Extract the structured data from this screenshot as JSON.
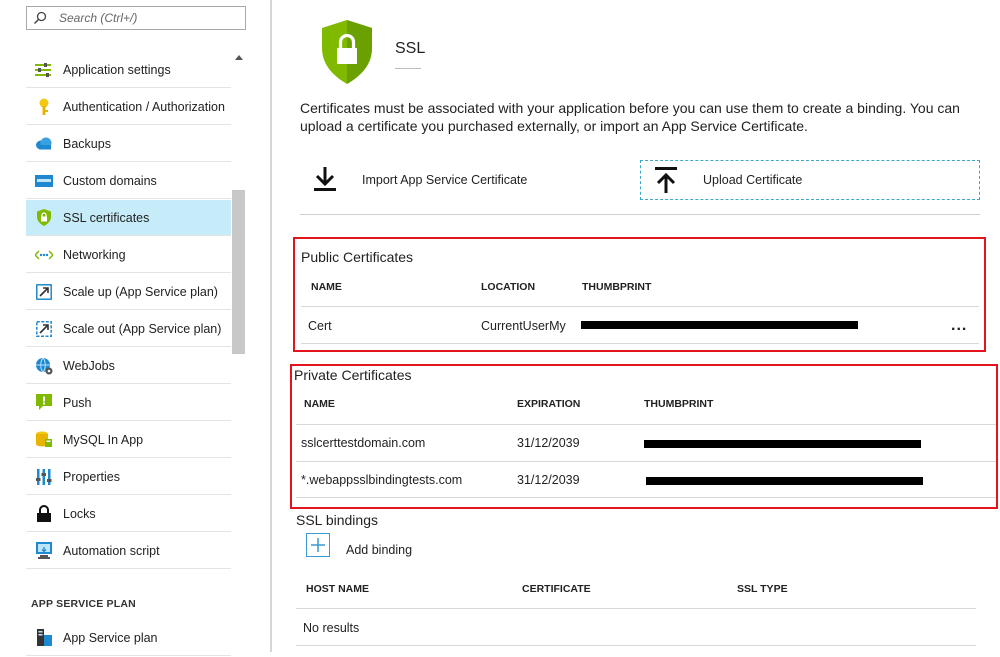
{
  "search": {
    "placeholder": "Search (Ctrl+/)"
  },
  "sidebar": {
    "items": [
      {
        "label": "Application settings",
        "icon": "settings-sliders-icon"
      },
      {
        "label": "Authentication / Authorization",
        "icon": "key-icon"
      },
      {
        "label": "Backups",
        "icon": "cloud-icon"
      },
      {
        "label": "Custom domains",
        "icon": "domain-icon"
      },
      {
        "label": "SSL certificates",
        "icon": "shield-lock-icon",
        "selected": true
      },
      {
        "label": "Networking",
        "icon": "networking-icon"
      },
      {
        "label": "Scale up (App Service plan)",
        "icon": "scale-up-icon"
      },
      {
        "label": "Scale out (App Service plan)",
        "icon": "scale-out-icon"
      },
      {
        "label": "WebJobs",
        "icon": "webjobs-icon"
      },
      {
        "label": "Push",
        "icon": "push-icon"
      },
      {
        "label": "MySQL In App",
        "icon": "mysql-icon"
      },
      {
        "label": "Properties",
        "icon": "properties-icon"
      },
      {
        "label": "Locks",
        "icon": "lock-icon"
      },
      {
        "label": "Automation script",
        "icon": "automation-script-icon"
      }
    ],
    "section_heading": "APP SERVICE PLAN",
    "plan_items": [
      {
        "label": "App Service plan",
        "icon": "app-service-plan-icon"
      }
    ]
  },
  "header": {
    "title": "SSL"
  },
  "description": "Certificates must be associated with your application before you can use them to create a binding. You can upload a certificate you purchased externally, or import an App Service Certificate.",
  "actions": {
    "import_label": "Import App Service Certificate",
    "upload_label": "Upload Certificate"
  },
  "public_certificates": {
    "title": "Public Certificates",
    "columns": [
      "NAME",
      "LOCATION",
      "THUMBPRINT"
    ],
    "rows": [
      {
        "name": "Cert",
        "location": "CurrentUserMy",
        "more": "..."
      }
    ]
  },
  "private_certificates": {
    "title": "Private Certificates",
    "columns": [
      "NAME",
      "EXPIRATION",
      "THUMBPRINT"
    ],
    "rows": [
      {
        "name": "sslcerttestdomain.com",
        "expiration": "31/12/2039"
      },
      {
        "name": "*.webappsslbindingtests.com",
        "expiration": "31/12/2039"
      }
    ]
  },
  "ssl_bindings": {
    "title": "SSL bindings",
    "add_label": "Add binding",
    "columns": [
      "HOST NAME",
      "CERTIFICATE",
      "SSL TYPE"
    ],
    "empty_text": "No results"
  },
  "colors": {
    "accent": "#0078d4",
    "selected_bg": "#c7ecf9",
    "highlight_red": "#e3141b",
    "shield_green": "#7fba00"
  }
}
